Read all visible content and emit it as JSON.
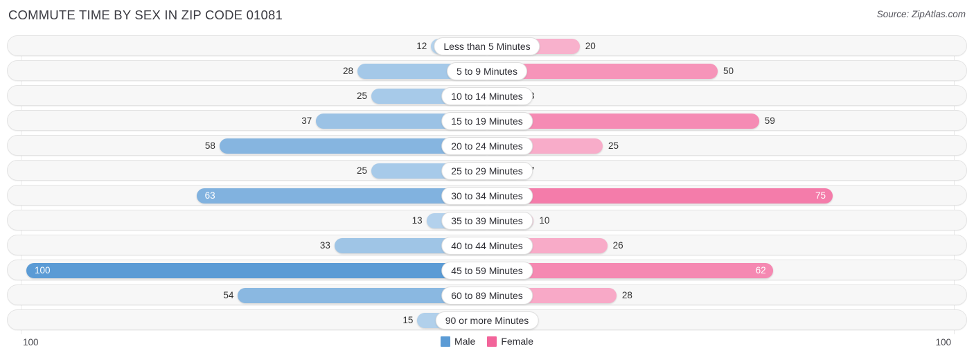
{
  "header": {
    "title": "COMMUTE TIME BY SEX IN ZIP CODE 01081",
    "source": "Source: ZipAtlas.com"
  },
  "legend": {
    "male_label": "Male",
    "female_label": "Female",
    "male_color": "#5b9bd5",
    "female_color": "#f2649a"
  },
  "axis": {
    "left_label": "100",
    "right_label": "100"
  },
  "chart_data": {
    "type": "bar",
    "orientation": "horizontal-diverging",
    "title": "COMMUTE TIME BY SEX IN ZIP CODE 01081",
    "xlabel": "",
    "ylabel": "",
    "xlim": [
      100,
      0,
      100
    ],
    "grid": true,
    "legend_position": "bottom-center",
    "categories": [
      "Less than 5 Minutes",
      "5 to 9 Minutes",
      "10 to 14 Minutes",
      "15 to 19 Minutes",
      "20 to 24 Minutes",
      "25 to 29 Minutes",
      "30 to 34 Minutes",
      "35 to 39 Minutes",
      "40 to 44 Minutes",
      "45 to 59 Minutes",
      "60 to 89 Minutes",
      "90 or more Minutes"
    ],
    "series": [
      {
        "name": "Male",
        "color": "#5b9bd5",
        "values": [
          12,
          28,
          25,
          37,
          58,
          25,
          63,
          13,
          33,
          100,
          54,
          15
        ]
      },
      {
        "name": "Female",
        "color": "#f2649a",
        "values": [
          20,
          50,
          3,
          59,
          25,
          7,
          75,
          10,
          26,
          62,
          28,
          0
        ]
      }
    ]
  }
}
